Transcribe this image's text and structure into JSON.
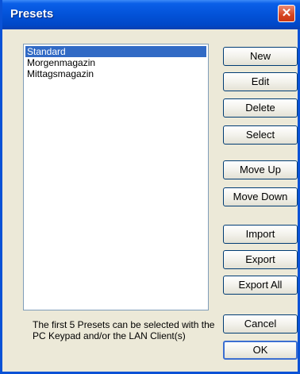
{
  "window": {
    "title": "Presets",
    "close_glyph": "✕"
  },
  "presets": {
    "items": [
      "Standard",
      "Morgenmagazin",
      "Mittagsmagazin"
    ],
    "selected_index": 0
  },
  "buttons": {
    "new": "New",
    "edit": "Edit",
    "delete": "Delete",
    "select": "Select",
    "move_up": "Move Up",
    "move_down": "Move Down",
    "import": "Import",
    "export": "Export",
    "export_all": "Export All",
    "cancel": "Cancel",
    "ok": "OK"
  },
  "info_text": "The first 5 Presets can be selected with the PC Keypad and/or the LAN Client(s)",
  "colors": {
    "titlebar": "#0352d8",
    "selection": "#316ac5",
    "dialog_bg": "#ece9d8",
    "close_button": "#d7451f"
  }
}
